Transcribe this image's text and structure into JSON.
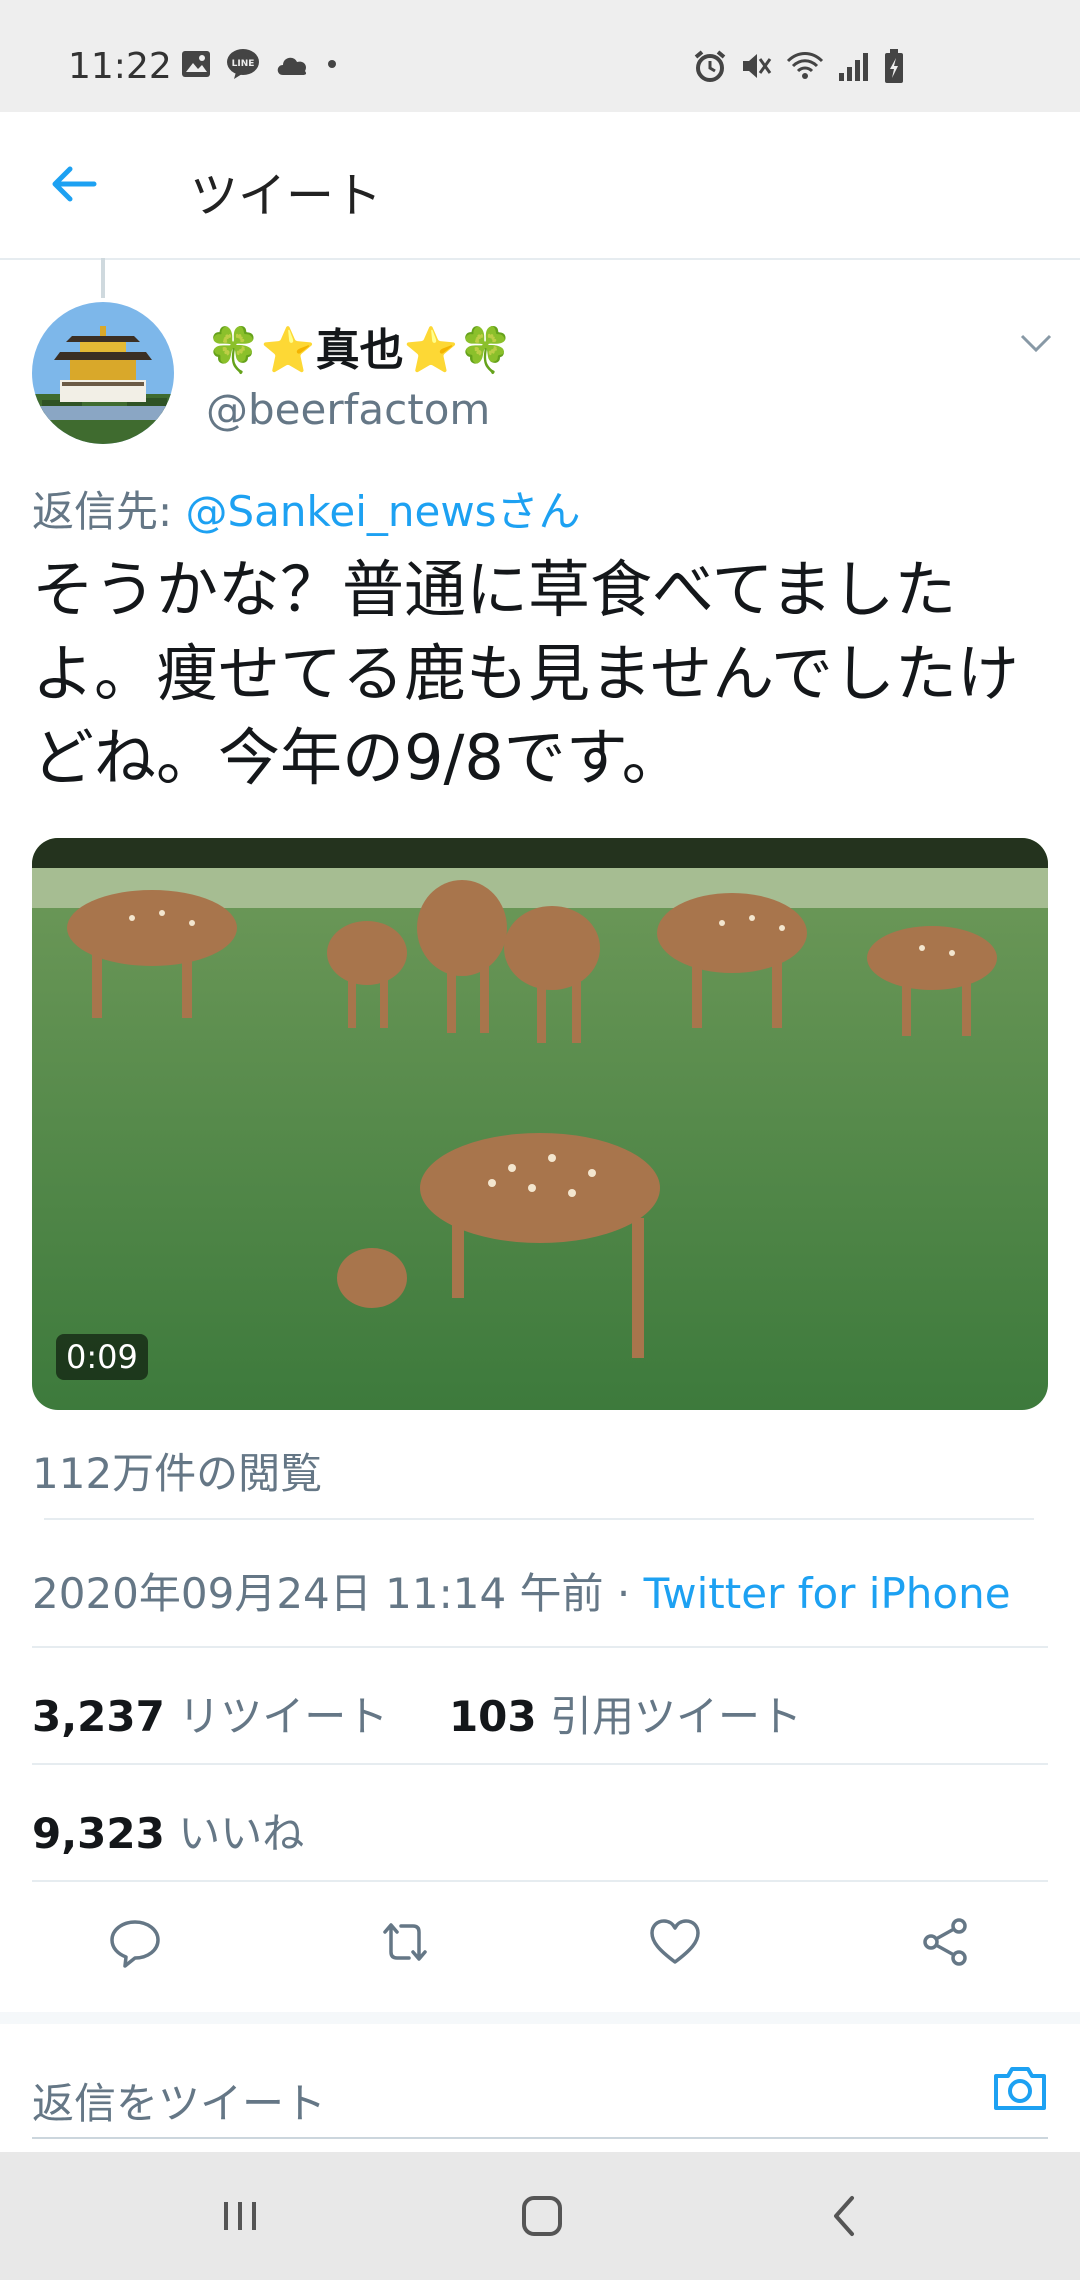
{
  "status_bar": {
    "time": "11:22",
    "left_icons": [
      "image-icon",
      "line-icon",
      "cloud-icon",
      "dot-icon"
    ],
    "right_icons": [
      "alarm-icon",
      "mute-icon",
      "wifi-icon",
      "signal-icon",
      "battery-charging-icon"
    ]
  },
  "header": {
    "back_icon": "arrow-left-icon",
    "title": "ツイート"
  },
  "tweet": {
    "display_name": "🍀⭐真也⭐🍀",
    "handle": "@beerfactom",
    "reply_prefix": "返信先: ",
    "reply_to": "@Sankei_newsさん",
    "text": "そうかな？普通に草食べてましたよ。痩せてる鹿も見ませんでしたけどね。今年の9/8です。",
    "media": {
      "type": "video",
      "duration": "0:09"
    },
    "views": "112万件の閲覧",
    "timestamp": "2020年09月24日 11:14 午前",
    "separator": " · ",
    "source": "Twitter for iPhone",
    "retweets_count": "3,237",
    "retweets_label": " リツイート",
    "quotes_count": "103",
    "quotes_label": " 引用ツイート",
    "likes_count": "9,323",
    "likes_label": " いいね"
  },
  "actions": [
    "reply-icon",
    "retweet-icon",
    "like-icon",
    "share-icon"
  ],
  "reply_box": {
    "placeholder": "返信をツイート",
    "camera_icon": "camera-icon"
  },
  "nav": [
    "recents-icon",
    "home-icon",
    "back-icon"
  ],
  "colors": {
    "accent": "#1da1f2",
    "secondary_text": "#657786",
    "primary_text": "#14171a"
  }
}
